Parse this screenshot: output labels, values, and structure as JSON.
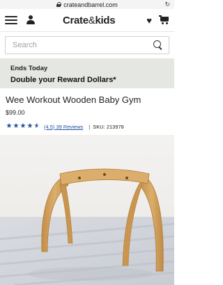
{
  "browser": {
    "url": "crateandbarrel.com",
    "reload_icon": "reload-icon"
  },
  "header": {
    "logo_main": "Crate",
    "logo_amp": "&",
    "logo_tail": "kids",
    "icons": [
      "menu-icon",
      "user-icon",
      "heart-icon",
      "cart-icon"
    ]
  },
  "search": {
    "placeholder": "Search",
    "value": ""
  },
  "promo": {
    "eyebrow": "Ends Today",
    "headline": "Double your Reward Dollars*",
    "background": "#e4e7e2"
  },
  "product": {
    "title": "Wee Workout Wooden Baby Gym",
    "price": "$99.00",
    "rating_value": 4.5,
    "rating_max": 5,
    "reviews_text": "(4.5) 39 Reviews",
    "separator": "|",
    "sku": "SKU: 213978",
    "accent": "#1f4f9c"
  },
  "image": {
    "alt": "Wooden baby gym on a rug",
    "wood_color": "#d4a35c"
  }
}
